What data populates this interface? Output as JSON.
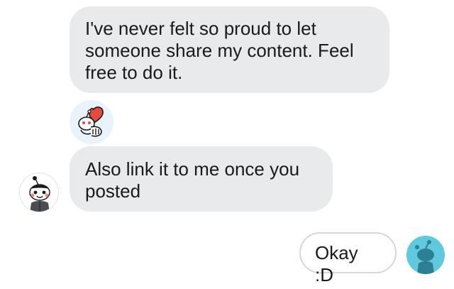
{
  "messages": [
    {
      "direction": "incoming",
      "lines": [
        "I've never felt so proud to let",
        "someone share my content. Feel",
        "free to do it."
      ]
    },
    {
      "direction": "incoming",
      "lines": [
        "Also link it to me once you",
        "posted"
      ]
    },
    {
      "direction": "outgoing",
      "lines": [
        "Okay :D"
      ]
    }
  ],
  "reaction": {
    "icon": "snoo-heart-sticker-icon"
  },
  "avatars": {
    "incoming": {
      "icon": "snoo-avatar-icon"
    },
    "outgoing": {
      "icon": "snoo-silhouette-avatar-icon"
    }
  },
  "colors": {
    "incoming_bubble": "#e9eaec",
    "outgoing_bubble_border": "#d7d7d9",
    "text": "#1a1a1b",
    "my_avatar_bg": "#5ec9df",
    "heart": "#e84a3c"
  }
}
